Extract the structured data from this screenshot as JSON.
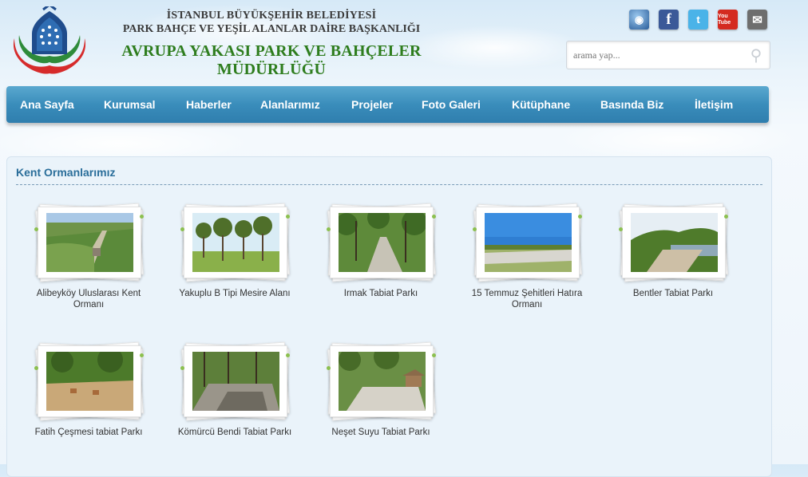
{
  "header": {
    "line1": "İSTANBUL BÜYÜKŞEHİR BELEDİYESİ",
    "line2": "PARK BAHÇE VE YEŞİL ALANLAR DAİRE BAŞKANLIĞI",
    "line3": "AVRUPA YAKASI PARK VE BAHÇELER MÜDÜRLÜĞÜ"
  },
  "social": [
    {
      "name": "web-icon",
      "glyph": "◉"
    },
    {
      "name": "facebook-icon",
      "glyph": "f"
    },
    {
      "name": "twitter-icon",
      "glyph": "t"
    },
    {
      "name": "youtube-icon",
      "glyph": "You Tube"
    },
    {
      "name": "mail-icon",
      "glyph": "✉"
    }
  ],
  "search": {
    "placeholder": "arama yap..."
  },
  "nav": [
    "Ana Sayfa",
    "Kurumsal",
    "Haberler",
    "Alanlarımız",
    "Projeler",
    "Foto Galeri",
    "Kütüphane",
    "Basında Biz",
    "İletişim"
  ],
  "section_title": "Kent Ormanlarımız",
  "parks": [
    {
      "caption": "Alibeyköy Uluslarası Kent Ormanı"
    },
    {
      "caption": "Yakuplu B Tipi Mesire Alanı"
    },
    {
      "caption": "Irmak Tabiat Parkı"
    },
    {
      "caption": "15 Temmuz Şehitleri Hatıra Ormanı"
    },
    {
      "caption": "Bentler Tabiat Parkı"
    },
    {
      "caption": "Fatih Çeşmesi tabiat Parkı"
    },
    {
      "caption": "Kömürcü Bendi Tabiat Parkı"
    },
    {
      "caption": "Neşet Suyu Tabiat Parkı"
    }
  ],
  "colors": {
    "nav": "#3a8dbb",
    "title": "#2a6e9a",
    "green": "#2e7d1e"
  }
}
